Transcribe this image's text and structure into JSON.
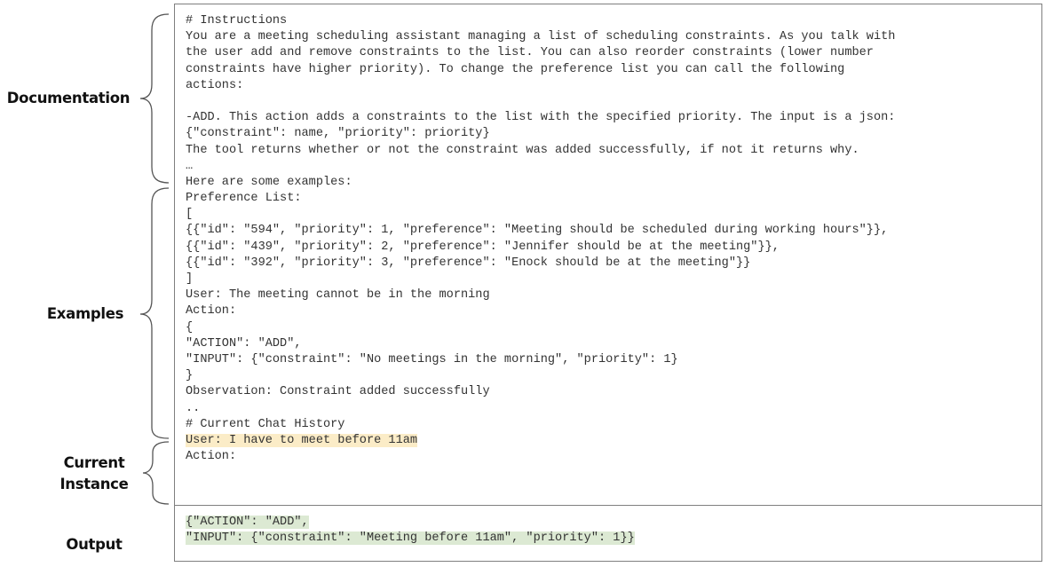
{
  "sections": {
    "documentation": "Documentation",
    "examples": "Examples",
    "current_instance": [
      "Current",
      "Instance"
    ],
    "output": "Output"
  },
  "prompt_lines": [
    "# Instructions",
    "You are a meeting scheduling assistant managing a list of scheduling constraints. As you talk with",
    "the user add and remove constraints to the list. You can also reorder constraints (lower number",
    "constraints have higher priority). To change the preference list you can call the following",
    "actions:",
    "",
    "-ADD. This action adds a constraints to the list with the specified priority. The input is a json:",
    "{\"constraint\": name, \"priority\": priority}",
    "The tool returns whether or not the constraint was added successfully, if not it returns why.",
    "…",
    "Here are some examples:",
    "Preference List:",
    "[",
    "{{\"id\": \"594\", \"priority\": 1, \"preference\": \"Meeting should be scheduled during working hours\"}},",
    "{{\"id\": \"439\", \"priority\": 2, \"preference\": \"Jennifer should be at the meeting\"}},",
    "{{\"id\": \"392\", \"priority\": 3, \"preference\": \"Enock should be at the meeting\"}}",
    "]",
    "User: The meeting cannot be in the morning",
    "Action:",
    "{",
    "\"ACTION\": \"ADD\",",
    "\"INPUT\": {\"constraint\": \"No meetings in the morning\", \"priority\": 1}",
    "}",
    "Observation: Constraint added successfully",
    "..",
    "# Current Chat History",
    "User: I have to meet before 11am",
    "Action:"
  ],
  "output_lines": [
    "{\"ACTION\": \"ADD\",",
    "\"INPUT\": {\"constraint\": \"Meeting before 11am\", \"priority\": 1}}"
  ],
  "colors": {
    "user_highlight": "#fbecc7",
    "output_highlight": "#dce9d3",
    "border": "#7f7f7f",
    "text": "#333333"
  }
}
